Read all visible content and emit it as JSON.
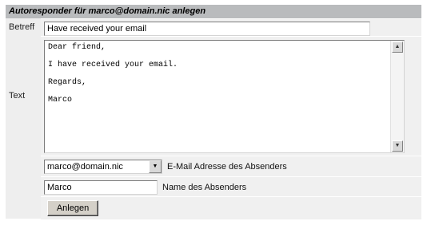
{
  "form": {
    "title": "Autoresponder für marco@domain.nic anlegen",
    "subject_label": "Betreff",
    "subject_value": "Have received your email",
    "text_label": "Text",
    "text_value": "Dear friend,\n\nI have received your email.\n\nRegards,\n\nMarco",
    "sender_email_selected": "marco@domain.nic",
    "sender_email_hint": "E-Mail Adresse des Absenders",
    "sender_name_value": "Marco",
    "sender_name_hint": "Name des Absenders",
    "submit_label": "Anlegen"
  },
  "icons": {
    "scroll_up": "arrow-up-icon",
    "scroll_down": "arrow-down-icon",
    "dropdown": "chevron-down-icon"
  },
  "colors": {
    "header_bg": "#b9bbbd",
    "label_bg": "#eeeeee",
    "cell_bg": "#f0f0f0",
    "button_bg": "#d4d0c8"
  }
}
